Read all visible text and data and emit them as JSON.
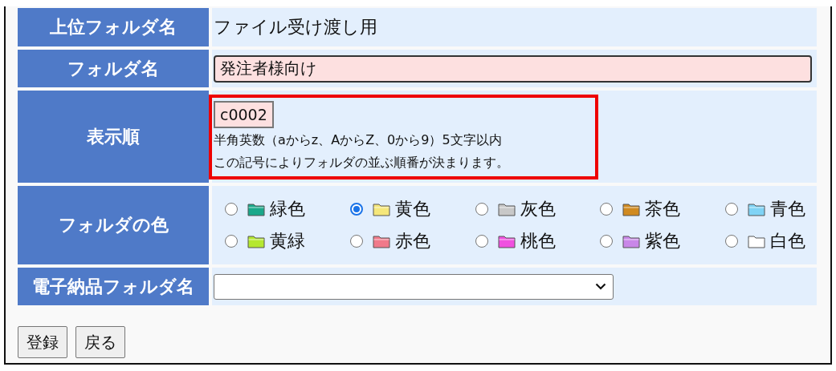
{
  "rows": [
    {
      "kind": "text",
      "label": "上位フォルダ名",
      "value": "ファイル受け渡し用"
    },
    {
      "kind": "input",
      "label": "フォルダ名",
      "value": "発注者様向け"
    },
    {
      "kind": "order",
      "label": "表示順",
      "value": "c0002",
      "hints": [
        "半角英数（aからz、AからZ、0から9）5文字以内",
        "この記号によりフォルダの並ぶ順番が決まります。"
      ],
      "highlighted": true
    },
    {
      "kind": "colors",
      "label": "フォルダの色",
      "options": [
        {
          "label": "緑色",
          "color": "#1aa88a",
          "selected": false
        },
        {
          "label": "黄色",
          "color": "#f5e77a",
          "selected": true
        },
        {
          "label": "灰色",
          "color": "#c8c8c8",
          "selected": false
        },
        {
          "label": "茶色",
          "color": "#d08a20",
          "selected": false
        },
        {
          "label": "青色",
          "color": "#7fd3f5",
          "selected": false
        },
        {
          "label": "黄緑",
          "color": "#b5e830",
          "selected": false
        },
        {
          "label": "赤色",
          "color": "#f07a8a",
          "selected": false
        },
        {
          "label": "桃色",
          "color": "#f050e0",
          "selected": false
        },
        {
          "label": "紫色",
          "color": "#c987e8",
          "selected": false
        },
        {
          "label": "白色",
          "color": "#ffffff",
          "selected": false
        }
      ]
    },
    {
      "kind": "select",
      "label": "電子納品フォルダ名"
    }
  ],
  "buttons": [
    "登録",
    "戻る"
  ]
}
